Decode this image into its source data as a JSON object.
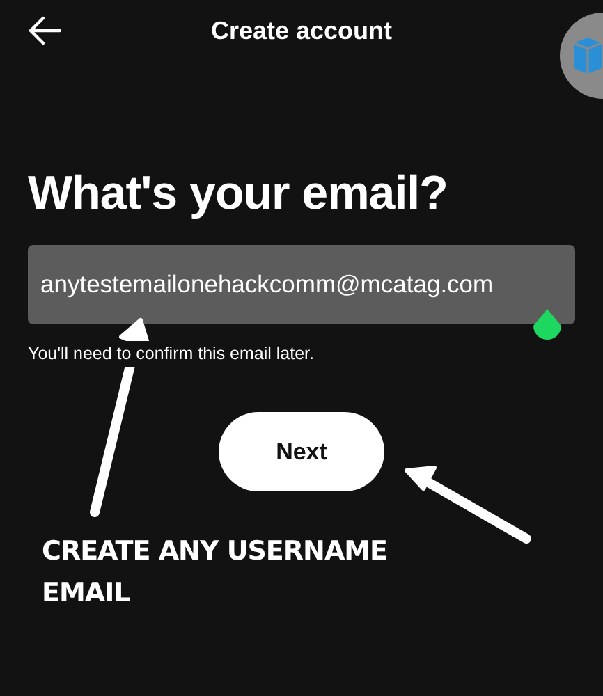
{
  "header": {
    "title": "Create account"
  },
  "heading": "What's your email?",
  "email_field": {
    "value": "anytestemailonehackcomm@mcatag.com"
  },
  "hint": "You'll need to confirm this email later.",
  "next_button": {
    "label": "Next"
  },
  "annotation": {
    "text": "CREATE ANY USERNAME EMAIL"
  }
}
